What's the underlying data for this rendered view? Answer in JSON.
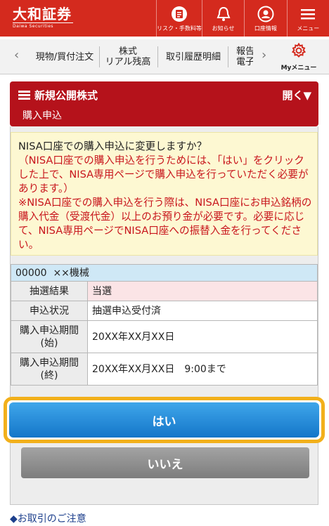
{
  "header": {
    "logo": "大和証券",
    "logo_sub": "Daiwa Securities",
    "nav": [
      {
        "label": "リスク・手数料等",
        "icon": "document-icon"
      },
      {
        "label": "お知らせ",
        "icon": "bell-icon"
      },
      {
        "label": "口座情報",
        "icon": "user-icon"
      },
      {
        "label": "メニュー",
        "icon": "menu-icon"
      }
    ]
  },
  "subnav": {
    "tabs": [
      "現物/買付注文",
      "株式\nリアル残高",
      "取引履歴明細",
      "報告\n電子"
    ],
    "mymenu": "Myメニュー"
  },
  "panel": {
    "title": "新規公開株式",
    "open": "開く▼",
    "subtitle": "購入申込"
  },
  "notice": {
    "question": "NISA口座での購入申込に変更しますか？",
    "line1": "（NISA口座での購入申込を行うためには、「はい」をクリックした上で、NISA専用ページで購入申込を行っていただく必要があります。）",
    "line2": "※NISA口座での購入申込を行う際は、NISA口座にお申込銘柄の購入代金（受渡代金）以上のお預り金が必要です。必要に応じて、NISA専用ページでNISA口座への振替入金を行ってください。"
  },
  "info": {
    "code": "00000",
    "name": "××機械",
    "rows": [
      {
        "label": "抽選結果",
        "value": "当選"
      },
      {
        "label": "申込状況",
        "value": "抽選申込受付済"
      },
      {
        "label": "購入申込期間\n(始)",
        "value": "20XX年XX月XX日"
      },
      {
        "label": "購入申込期間\n(終)",
        "value": "20XX年XX月XX日　9:00まで"
      }
    ]
  },
  "buttons": {
    "yes": "はい",
    "no": "いいえ"
  },
  "footer": {
    "link": "◆お取引のご注意"
  },
  "colors": {
    "header_red": "#d42a1e",
    "panel_red": "#b5121b",
    "yes_blue": "#1e86d8",
    "highlight_orange": "#f2b01b",
    "notice_red": "#c8151c"
  }
}
